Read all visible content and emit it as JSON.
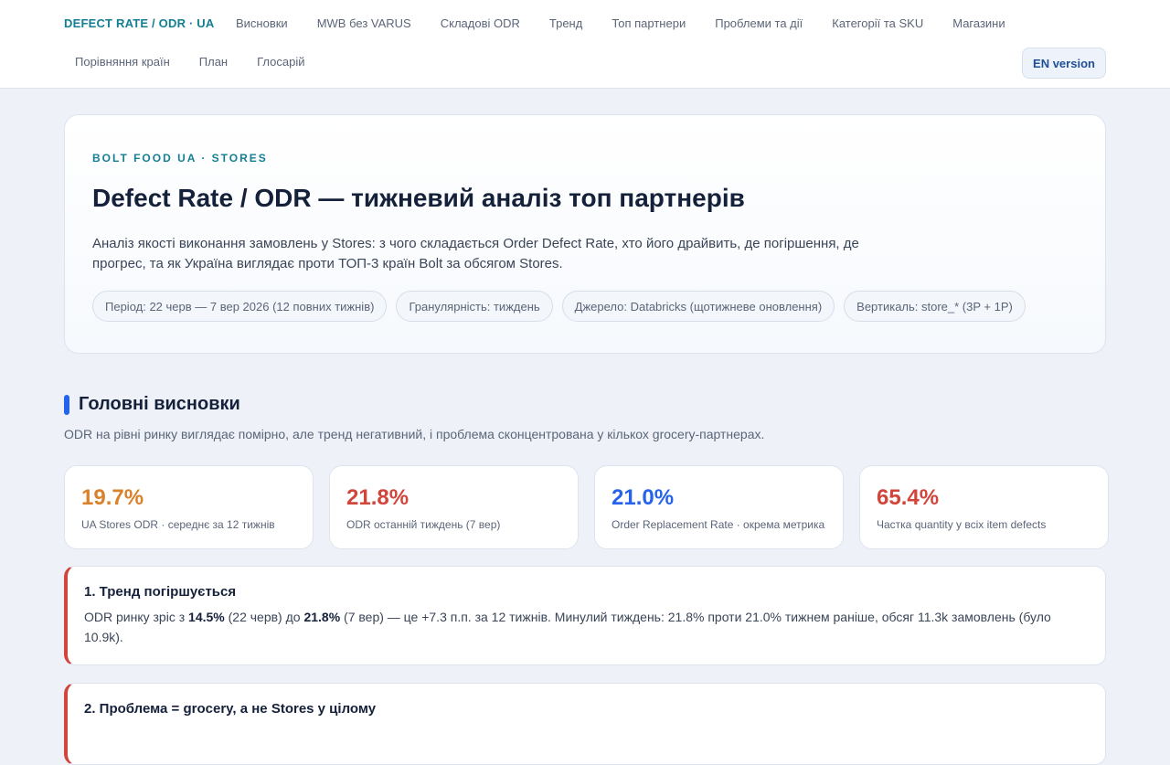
{
  "nav": {
    "brand": "DEFECT RATE / ODR · UA",
    "links_row1": [
      "Висновки",
      "MWB без VARUS",
      "Складові ODR",
      "Тренд",
      "Топ партнери",
      "Проблеми та дії",
      "Категорії та SKU",
      "Магазини"
    ],
    "links_row2": [
      "Порівняння країн",
      "План",
      "Глосарій"
    ],
    "lang_button": "EN version"
  },
  "hero": {
    "eyebrow": "BOLT FOOD UA · STORES",
    "title": "Defect Rate / ODR — тижневий аналіз топ партнерів",
    "description": "Аналіз якості виконання замовлень у Stores: з чого складається Order Defect Rate, хто його драйвить, де погіршення, де прогрес, та як Україна виглядає проти ТОП-3 країн Bolt за обсягом Stores.",
    "pills": [
      "Період: 22 черв — 7 вер 2026 (12 повних тижнів)",
      "Гранулярність: тиждень",
      "Джерело: Databricks (щотижневе оновлення)",
      "Вертикаль: store_* (3P + 1P)"
    ]
  },
  "section": {
    "title": "Головні висновки",
    "subtitle": "ODR на рівні ринку виглядає помірно, але тренд негативний, і проблема сконцентрована у кількох grocery-партнерах."
  },
  "kpis": [
    {
      "value": "19.7%",
      "label": "UA Stores ODR · середнє за 12 тижнів",
      "color": "#d9822b"
    },
    {
      "value": "21.8%",
      "label": "ODR останній тиждень (7 вер)",
      "color": "#d1453b"
    },
    {
      "value": "21.0%",
      "label": "Order Replacement Rate · окрема метрика",
      "color": "#2563eb"
    },
    {
      "value": "65.4%",
      "label": "Частка quantity у всіх item defects",
      "color": "#d1453b"
    }
  ],
  "findings": [
    {
      "title": "1. Тренд погіршується",
      "text_pre": "ODR ринку зріс з ",
      "b1": "14.5%",
      "text_mid": " (22 черв) до ",
      "b2": "21.8%",
      "text_post": " (7 вер) — це +7.3 п.п. за 12 тижнів. Минулий тиждень: 21.8% проти 21.0% тижнем раніше, обсяг 11.3k замовлень (було 10.9k)."
    },
    {
      "title": "2. Проблема = grocery, а не Stores у цілому"
    }
  ]
}
